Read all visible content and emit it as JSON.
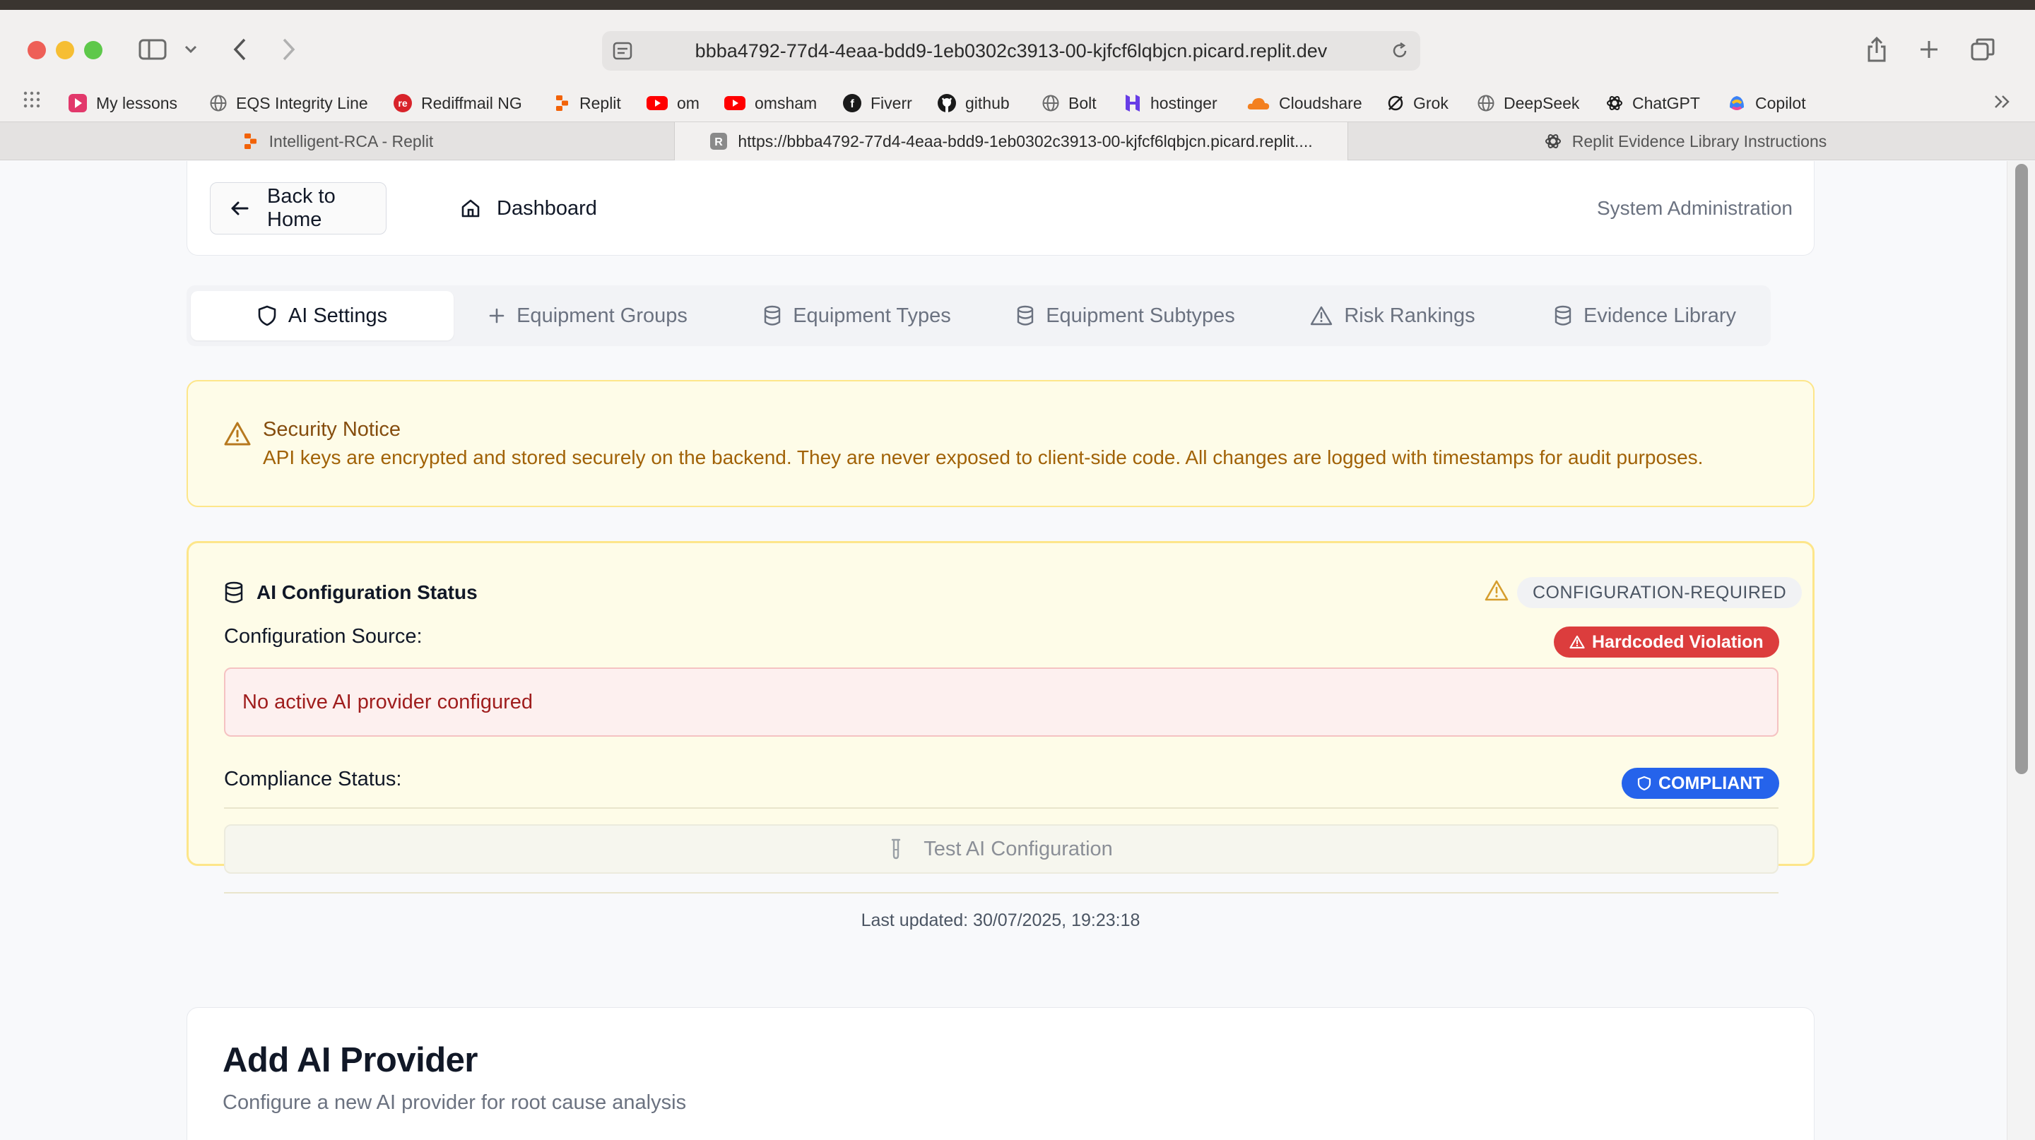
{
  "browser": {
    "url": "bbba4792-77d4-4eaa-bdd9-1eb0302c3913-00-kjfcf6lqbjcn.picard.replit.dev",
    "bookmarks": [
      {
        "label": "My lessons",
        "icon": "play-icon",
        "color": "#e2386b"
      },
      {
        "label": "EQS Integrity Line",
        "icon": "globe-icon",
        "color": "#6b6b6b"
      },
      {
        "label": "Rediffmail NG",
        "icon": "rediff-icon",
        "color": "#d8232a"
      },
      {
        "label": "Replit",
        "icon": "replit-icon",
        "color": "#f26207"
      },
      {
        "label": "om",
        "icon": "youtube-icon",
        "color": "#ff0000"
      },
      {
        "label": "omsham",
        "icon": "youtube-icon",
        "color": "#ff0000"
      },
      {
        "label": "Fiverr",
        "icon": "fiverr-icon",
        "color": "#1a1a1a"
      },
      {
        "label": "github",
        "icon": "github-icon",
        "color": "#1a1a1a"
      },
      {
        "label": "Bolt",
        "icon": "globe-icon",
        "color": "#6b6b6b"
      },
      {
        "label": "hostinger",
        "icon": "hostinger-icon",
        "color": "#673de6"
      },
      {
        "label": "Cloudshare",
        "icon": "cloud-icon",
        "color": "#f38020"
      },
      {
        "label": "Grok",
        "icon": "grok-icon",
        "color": "#1a1a1a"
      },
      {
        "label": "DeepSeek",
        "icon": "globe-icon",
        "color": "#6b6b6b"
      },
      {
        "label": "ChatGPT",
        "icon": "chatgpt-icon",
        "color": "#1a1a1a"
      },
      {
        "label": "Copilot",
        "icon": "copilot-icon",
        "color": "#3b82f6"
      }
    ],
    "tabs": [
      {
        "label": "Intelligent-RCA - Replit",
        "icon": "replit-icon",
        "active": false
      },
      {
        "label": "https://bbba4792-77d4-4eaa-bdd9-1eb0302c3913-00-kjfcf6lqbjcn.picard.replit....",
        "icon": "r-letter-icon",
        "active": true
      },
      {
        "label": "Replit Evidence Library Instructions",
        "icon": "chatgpt-icon",
        "active": false
      }
    ]
  },
  "nav": {
    "back_label": "Back to Home",
    "dashboard_label": "Dashboard",
    "section_label": "System Administration"
  },
  "admin_tabs": [
    {
      "label": "AI Settings",
      "icon": "shield-icon",
      "active": true
    },
    {
      "label": "Equipment Groups",
      "icon": "plus-icon",
      "active": false
    },
    {
      "label": "Equipment Types",
      "icon": "database-icon",
      "active": false
    },
    {
      "label": "Equipment Subtypes",
      "icon": "database-icon",
      "active": false
    },
    {
      "label": "Risk Rankings",
      "icon": "warning-icon",
      "active": false
    },
    {
      "label": "Evidence Library",
      "icon": "database-icon",
      "active": false
    }
  ],
  "security_notice": {
    "title": "Security Notice",
    "body": "API keys are encrypted and stored securely on the backend. They are never exposed to client-side code. All changes are logged with timestamps for audit purposes."
  },
  "ai_status": {
    "title": "AI Configuration Status",
    "status_badge": "CONFIGURATION-REQUIRED",
    "config_source_label": "Configuration Source:",
    "violation_badge": "Hardcoded Violation",
    "error_message": "No active AI provider configured",
    "compliance_label": "Compliance Status:",
    "compliance_badge": "COMPLIANT",
    "test_button": "Test AI Configuration",
    "last_updated": "Last updated: 30/07/2025, 19:23:18"
  },
  "add_provider": {
    "title": "Add AI Provider",
    "subtitle": "Configure a new AI provider for root cause analysis"
  },
  "colors": {
    "notice_bg": "#fefce8",
    "notice_border": "#fde68a",
    "violation": "#dc3d3d",
    "compliant": "#2563eb",
    "error_text": "#9f1d1d"
  }
}
